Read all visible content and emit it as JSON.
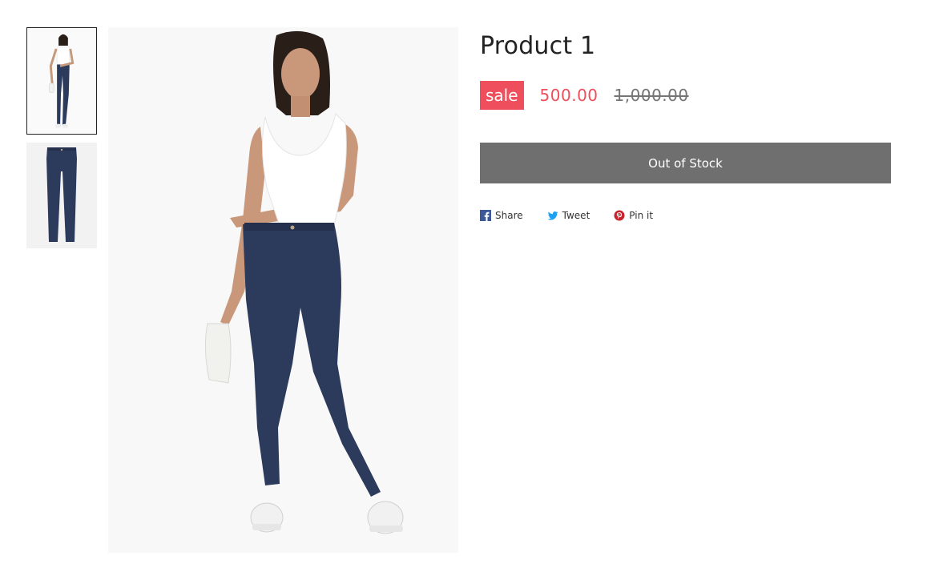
{
  "product": {
    "title": "Product 1",
    "sale_badge": "sale",
    "sale_price": "500.00",
    "compare_price": "1,000.00",
    "stock_button_label": "Out of Stock"
  },
  "gallery": {
    "thumbnails": [
      {
        "name": "model-front-view"
      },
      {
        "name": "jeans-flat-view"
      }
    ],
    "selected_index": 0
  },
  "share": {
    "facebook_label": "Share",
    "twitter_label": "Tweet",
    "pinterest_label": "Pin it"
  },
  "colors": {
    "sale": "#ef4f5c",
    "button": "#6f6f6f",
    "facebook": "#3b5998",
    "twitter": "#1da1f2",
    "pinterest": "#c8232c",
    "denim": "#2c3a5c"
  },
  "icons": {
    "facebook": "facebook-icon",
    "twitter": "twitter-icon",
    "pinterest": "pinterest-icon"
  }
}
